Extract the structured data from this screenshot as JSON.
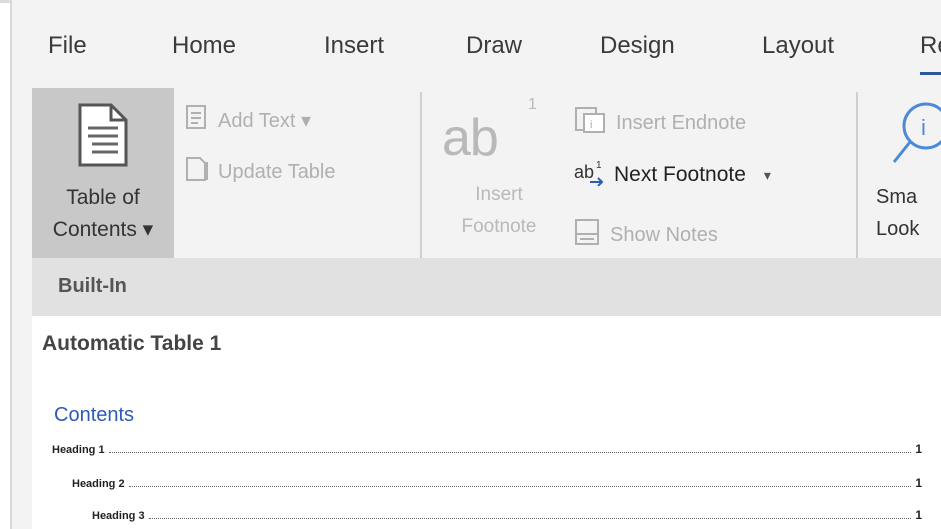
{
  "tabs": [
    {
      "label": "File"
    },
    {
      "label": "Home"
    },
    {
      "label": "Insert"
    },
    {
      "label": "Draw"
    },
    {
      "label": "Design"
    },
    {
      "label": "Layout"
    },
    {
      "label": "Re"
    }
  ],
  "ribbon": {
    "table_of_contents": {
      "line1": "Table of",
      "line2": "Contents ▾"
    },
    "add_text": "Add Text ▾",
    "update_table": "Update Table",
    "insert_footnote": {
      "icon_text": "ab",
      "superscript": "1",
      "line1": "Insert",
      "line2": "Footnote"
    },
    "insert_endnote": "Insert Endnote",
    "next_footnote": "Next Footnote",
    "next_footnote_dropdown": "▾",
    "show_notes": "Show Notes",
    "smart_lookup": {
      "line1": "Sma",
      "line2": "Look"
    }
  },
  "dropdown": {
    "section_header": "Built-In",
    "item_title": "Automatic Table 1",
    "preview": {
      "heading": "Contents",
      "rows": [
        {
          "label": "Heading 1",
          "page": "1"
        },
        {
          "label": "Heading 2",
          "page": "1"
        },
        {
          "label": "Heading 3",
          "page": "1"
        }
      ]
    }
  },
  "colors": {
    "accent": "#2b579a",
    "contents_blue": "#2e5bb8",
    "disabled": "#b0b0b0"
  }
}
